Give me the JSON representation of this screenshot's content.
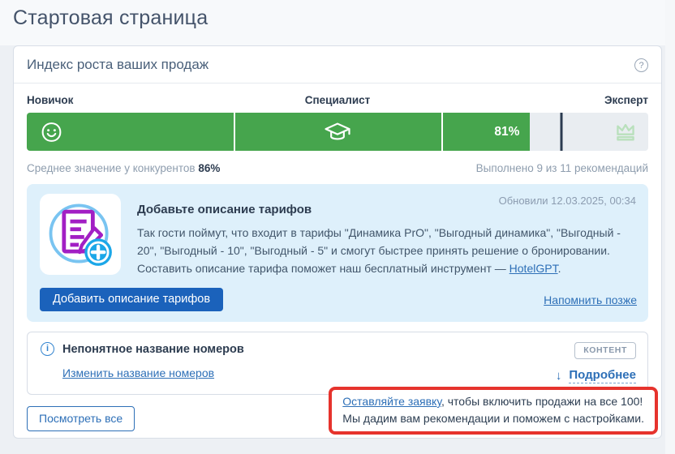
{
  "colors": {
    "green": "#46a54d",
    "accent_blue": "#2d6fb7",
    "button_blue": "#1b62bb",
    "panel_blue": "#def0fb",
    "red": "#e6332d",
    "tick_navy": "#2b3a50",
    "crown_green": "#b9e0bc"
  },
  "page": {
    "title": "Стартовая страница"
  },
  "card": {
    "header": {
      "title": "Индекс роста ваших продаж",
      "help_icon": "?"
    },
    "progress": {
      "levels": [
        "Новичок",
        "Специалист",
        "Эксперт"
      ],
      "percent": 81,
      "percent_label": "81%",
      "competitor_percent": 86,
      "segment_dividers": [
        33.333,
        66.667
      ],
      "competitor_prefix": "Среднее значение у конкурентов",
      "competitor_value": "86%",
      "completed_text": "Выполнено 9 из 11 рекомендаций"
    },
    "recommendation": {
      "updated": "Обновили 12.03.2025, 00:34",
      "title": "Добавьте описание тарифов",
      "body": "Так гости поймут, что входит в тарифы \"Динамика PrO\", \"Выгодный динамика\", \"Выгодный - 20\", \"Выгодный - 10\", \"Выгодный - 5\" и смогут быстрее принять решение о бронировании. Составить описание тарифа поможет наш бесплатный инструмент — ",
      "body_link": "HotelGPT",
      "body_suffix": ".",
      "primary_button": "Добавить описание тарифов",
      "remind_link": "Напомнить позже"
    },
    "issue": {
      "title": "Непонятное название номеров",
      "badge": "КОНТЕНТ",
      "action_link": "Изменить название номеров",
      "details_label": "Подробнее",
      "details_arrow": "↓"
    },
    "view_all_button": "Посмотреть все",
    "callout": {
      "link_text": "Оставляйте заявку",
      "line1_rest": ", чтобы включить продажи на все 100!",
      "line2": "Мы дадим вам рекомендации и поможем с настройками."
    }
  }
}
